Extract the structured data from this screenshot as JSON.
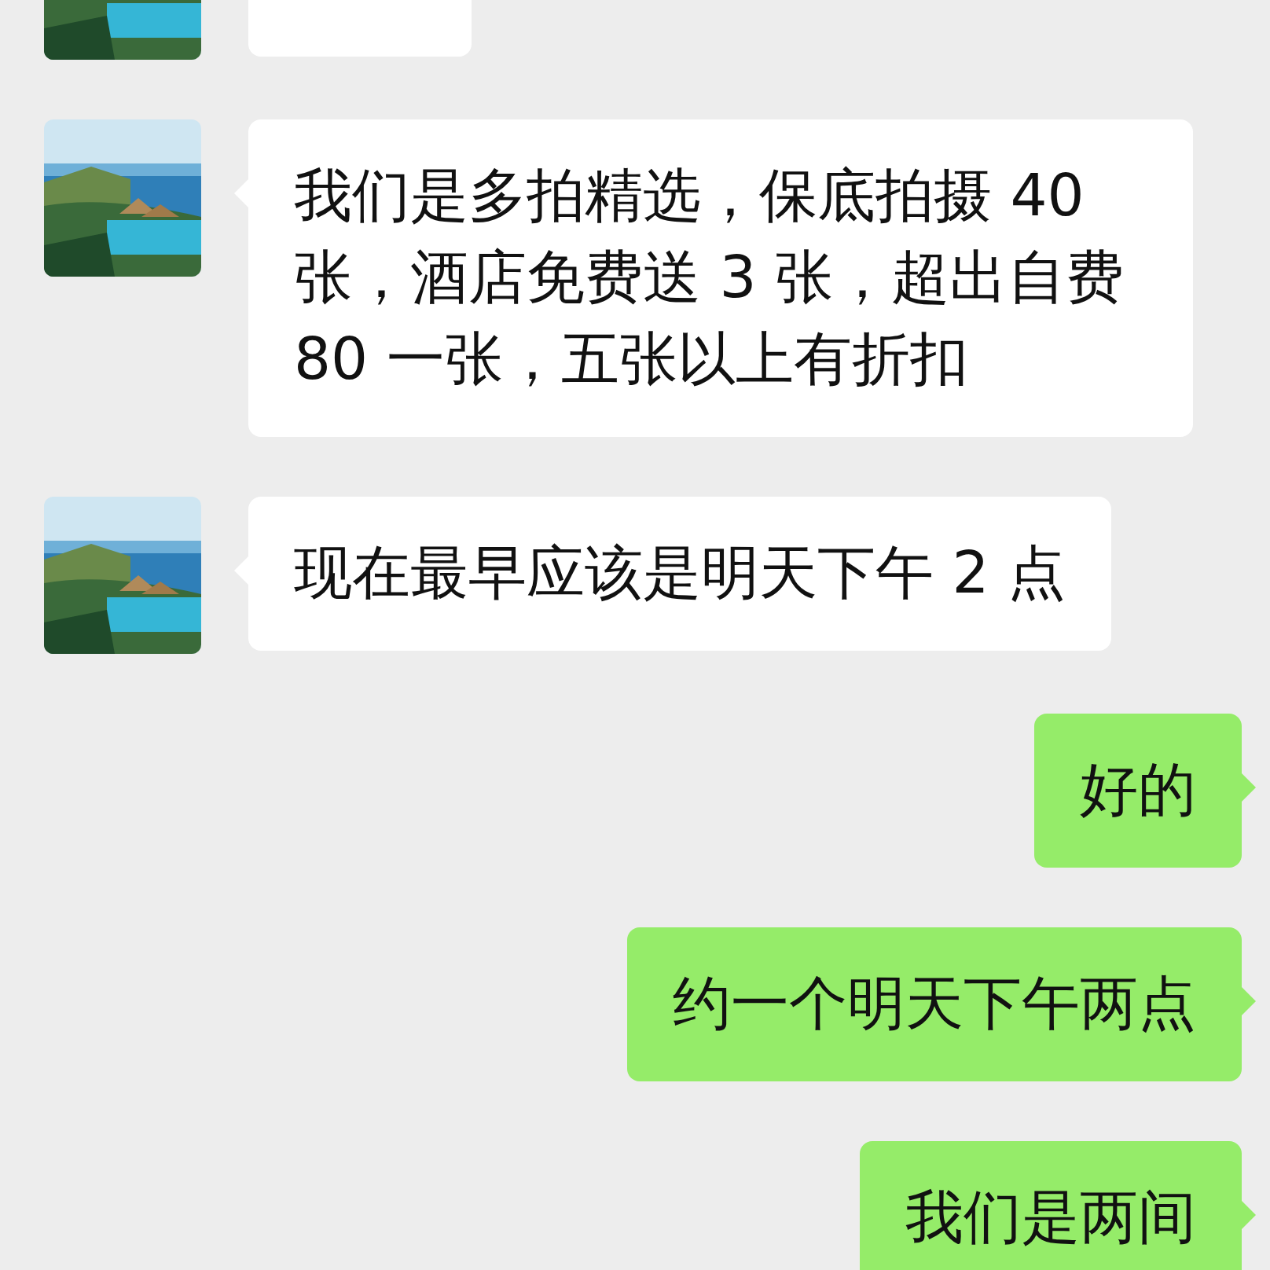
{
  "messages": [
    {
      "kind": "received"
    },
    {
      "kind": "received",
      "text": "我们是多拍精选，保底拍摄 40 张，酒店免费送 3 张，超出自费 80 一张，五张以上有折扣"
    },
    {
      "kind": "received",
      "text": "现在最早应该是明天下午 2 点"
    },
    {
      "kind": "sent",
      "text": "好的"
    },
    {
      "kind": "sent",
      "text": "约一个明天下午两点"
    },
    {
      "kind": "sent",
      "text": "我们是两间"
    }
  ]
}
